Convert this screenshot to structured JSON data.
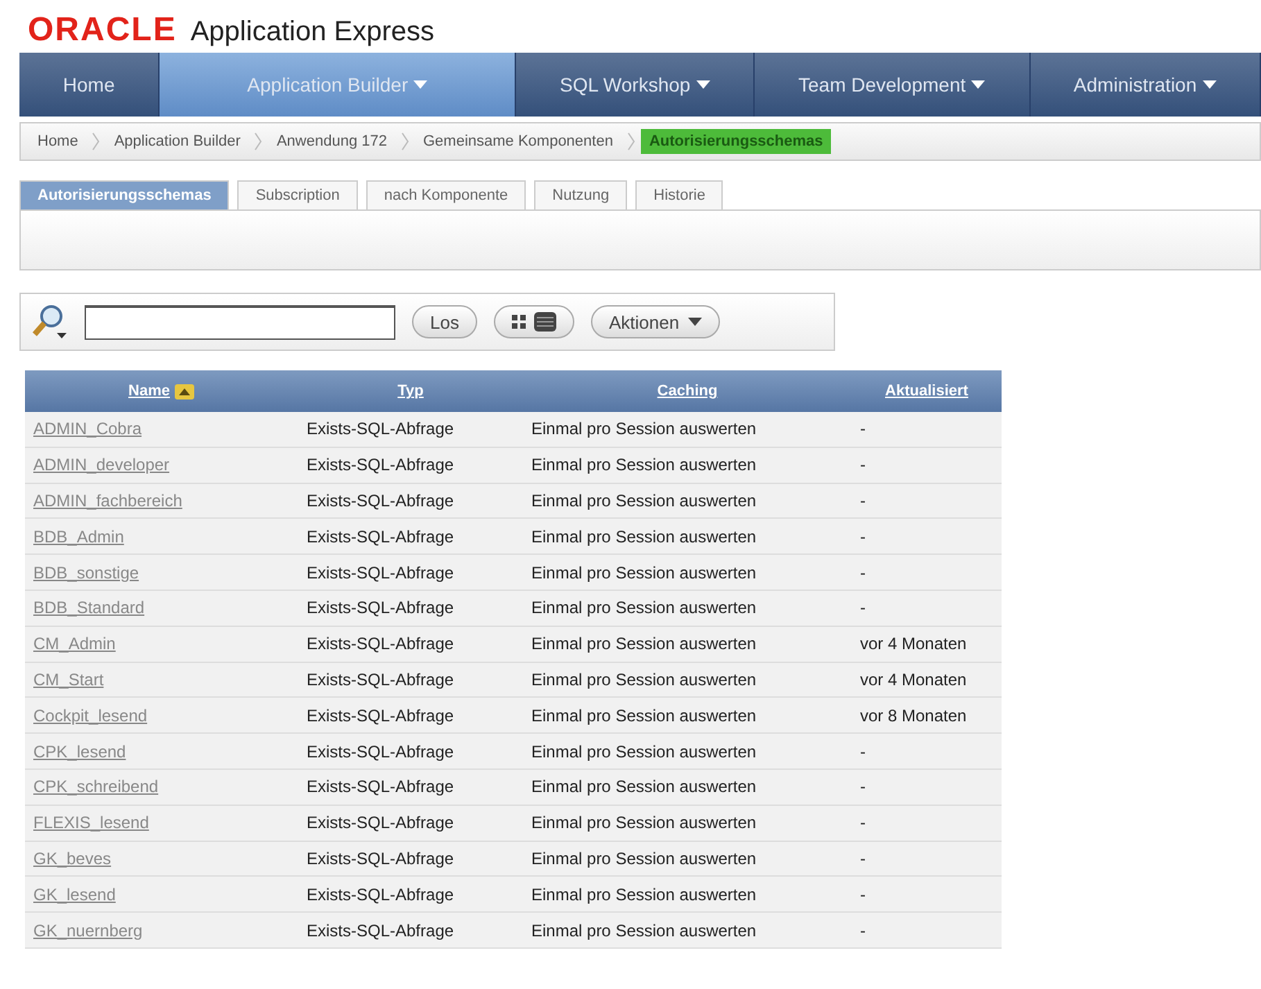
{
  "header": {
    "logo": "ORACLE",
    "product": "Application Express"
  },
  "nav": [
    {
      "label": "Home",
      "selected": false,
      "dropdown": false
    },
    {
      "label": "Application Builder",
      "selected": true,
      "dropdown": true
    },
    {
      "label": "SQL Workshop",
      "selected": false,
      "dropdown": true
    },
    {
      "label": "Team Development",
      "selected": false,
      "dropdown": true
    },
    {
      "label": "Administration",
      "selected": false,
      "dropdown": true
    }
  ],
  "breadcrumb": [
    {
      "label": "Home",
      "selected": false
    },
    {
      "label": "Application Builder",
      "selected": false
    },
    {
      "label": "Anwendung 172",
      "selected": false
    },
    {
      "label": "Gemeinsame Komponenten",
      "selected": false
    },
    {
      "label": "Autorisierungsschemas",
      "selected": true
    }
  ],
  "tabs": [
    {
      "label": "Autorisierungsschemas",
      "selected": true
    },
    {
      "label": "Subscription",
      "selected": false
    },
    {
      "label": "nach Komponente",
      "selected": false
    },
    {
      "label": "Nutzung",
      "selected": false
    },
    {
      "label": "Historie",
      "selected": false
    }
  ],
  "search": {
    "go": "Los",
    "actions": "Aktionen"
  },
  "table": {
    "columns": [
      {
        "label": "Name",
        "sorted": true
      },
      {
        "label": "Typ",
        "sorted": false
      },
      {
        "label": "Caching",
        "sorted": false
      },
      {
        "label": "Aktualisiert",
        "sorted": false
      }
    ],
    "rows": [
      [
        "ADMIN_Cobra",
        "Exists-SQL-Abfrage",
        "Einmal pro Session auswerten",
        "-"
      ],
      [
        "ADMIN_developer",
        "Exists-SQL-Abfrage",
        "Einmal pro Session auswerten",
        "-"
      ],
      [
        "ADMIN_fachbereich",
        "Exists-SQL-Abfrage",
        "Einmal pro Session auswerten",
        "-"
      ],
      [
        "BDB_Admin",
        "Exists-SQL-Abfrage",
        "Einmal pro Session auswerten",
        "-"
      ],
      [
        "BDB_sonstige",
        "Exists-SQL-Abfrage",
        "Einmal pro Session auswerten",
        "-"
      ],
      [
        "BDB_Standard",
        "Exists-SQL-Abfrage",
        "Einmal pro Session auswerten",
        "-"
      ],
      [
        "CM_Admin",
        "Exists-SQL-Abfrage",
        "Einmal pro Session auswerten",
        "vor 4 Monaten"
      ],
      [
        "CM_Start",
        "Exists-SQL-Abfrage",
        "Einmal pro Session auswerten",
        "vor 4 Monaten"
      ],
      [
        "Cockpit_lesend",
        "Exists-SQL-Abfrage",
        "Einmal pro Session auswerten",
        "vor 8 Monaten"
      ],
      [
        "CPK_lesend",
        "Exists-SQL-Abfrage",
        "Einmal pro Session auswerten",
        "-"
      ],
      [
        "CPK_schreibend",
        "Exists-SQL-Abfrage",
        "Einmal pro Session auswerten",
        "-"
      ],
      [
        "FLEXIS_lesend",
        "Exists-SQL-Abfrage",
        "Einmal pro Session auswerten",
        "-"
      ],
      [
        "GK_beves",
        "Exists-SQL-Abfrage",
        "Einmal pro Session auswerten",
        "-"
      ],
      [
        "GK_lesend",
        "Exists-SQL-Abfrage",
        "Einmal pro Session auswerten",
        "-"
      ],
      [
        "GK_nuernberg",
        "Exists-SQL-Abfrage",
        "Einmal pro Session auswerten",
        "-"
      ]
    ]
  }
}
